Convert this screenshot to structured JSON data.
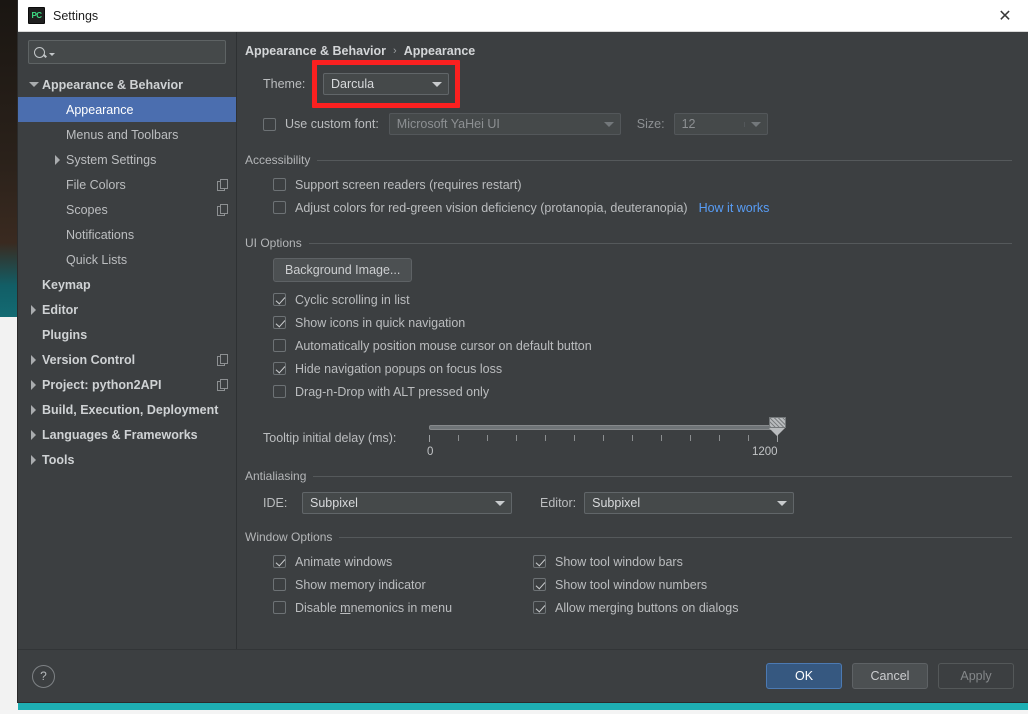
{
  "window": {
    "title": "Settings",
    "icon": "pycharm-icon",
    "close_label": "✕"
  },
  "search": {
    "value": "",
    "placeholder": ""
  },
  "sidebar": {
    "items": [
      {
        "label": "Appearance & Behavior",
        "indent": 0,
        "arrow": "down",
        "bold": true,
        "selected": false,
        "copy": false
      },
      {
        "label": "Appearance",
        "indent": 1,
        "arrow": "none",
        "bold": false,
        "selected": true,
        "copy": false
      },
      {
        "label": "Menus and Toolbars",
        "indent": 1,
        "arrow": "none",
        "bold": false,
        "selected": false,
        "copy": false
      },
      {
        "label": "System Settings",
        "indent": 1,
        "arrow": "right",
        "bold": false,
        "selected": false,
        "copy": false
      },
      {
        "label": "File Colors",
        "indent": 1,
        "arrow": "none",
        "bold": false,
        "selected": false,
        "copy": true
      },
      {
        "label": "Scopes",
        "indent": 1,
        "arrow": "none",
        "bold": false,
        "selected": false,
        "copy": true
      },
      {
        "label": "Notifications",
        "indent": 1,
        "arrow": "none",
        "bold": false,
        "selected": false,
        "copy": false
      },
      {
        "label": "Quick Lists",
        "indent": 1,
        "arrow": "none",
        "bold": false,
        "selected": false,
        "copy": false
      },
      {
        "label": "Keymap",
        "indent": 0,
        "arrow": "none",
        "bold": true,
        "selected": false,
        "copy": false
      },
      {
        "label": "Editor",
        "indent": 0,
        "arrow": "right",
        "bold": true,
        "selected": false,
        "copy": false
      },
      {
        "label": "Plugins",
        "indent": 0,
        "arrow": "none",
        "bold": true,
        "selected": false,
        "copy": false
      },
      {
        "label": "Version Control",
        "indent": 0,
        "arrow": "right",
        "bold": true,
        "selected": false,
        "copy": true
      },
      {
        "label": "Project: python2API",
        "indent": 0,
        "arrow": "right",
        "bold": true,
        "selected": false,
        "copy": true
      },
      {
        "label": "Build, Execution, Deployment",
        "indent": 0,
        "arrow": "right",
        "bold": true,
        "selected": false,
        "copy": false
      },
      {
        "label": "Languages & Frameworks",
        "indent": 0,
        "arrow": "right",
        "bold": true,
        "selected": false,
        "copy": false
      },
      {
        "label": "Tools",
        "indent": 0,
        "arrow": "right",
        "bold": true,
        "selected": false,
        "copy": false
      }
    ]
  },
  "breadcrumb": {
    "parent": "Appearance & Behavior",
    "separator": "›",
    "current": "Appearance"
  },
  "theme": {
    "label": "Theme:",
    "value": "Darcula",
    "highlight_color": "#fb2020"
  },
  "font": {
    "checkbox_label": "Use custom font:",
    "checked": false,
    "value": "Microsoft YaHei UI",
    "size_label": "Size:",
    "size_value": "12"
  },
  "accessibility": {
    "title": "Accessibility",
    "options": [
      {
        "label": "Support screen readers (requires restart)",
        "checked": false
      },
      {
        "label": "Adjust colors for red-green vision deficiency (protanopia, deuteranopia)",
        "checked": false
      }
    ],
    "link": "How it works"
  },
  "ui_options": {
    "title": "UI Options",
    "background_button": "Background Image...",
    "options": [
      {
        "label": "Cyclic scrolling in list",
        "checked": true
      },
      {
        "label": "Show icons in quick navigation",
        "checked": true
      },
      {
        "label": "Automatically position mouse cursor on default button",
        "checked": false
      },
      {
        "label": "Hide navigation popups on focus loss",
        "checked": true
      },
      {
        "label": "Drag-n-Drop with ALT pressed only",
        "checked": false
      }
    ],
    "slider": {
      "label": "Tooltip initial delay (ms):",
      "min_label": "0",
      "max_label": "1200",
      "value": 1200
    }
  },
  "antialiasing": {
    "title": "Antialiasing",
    "ide_label": "IDE:",
    "ide_value": "Subpixel",
    "editor_label": "Editor:",
    "editor_value": "Subpixel"
  },
  "window_options": {
    "title": "Window Options",
    "left": [
      {
        "label": "Animate windows",
        "checked": true
      },
      {
        "label": "Show memory indicator",
        "checked": false
      },
      {
        "label": "Disable mnemonics in menu",
        "checked": false,
        "underline": "m"
      }
    ],
    "right": [
      {
        "label": "Show tool window bars",
        "checked": true
      },
      {
        "label": "Show tool window numbers",
        "checked": true
      },
      {
        "label": "Allow merging buttons on dialogs",
        "checked": true
      }
    ]
  },
  "footer": {
    "help": "?",
    "ok": "OK",
    "cancel": "Cancel",
    "apply": "Apply"
  }
}
